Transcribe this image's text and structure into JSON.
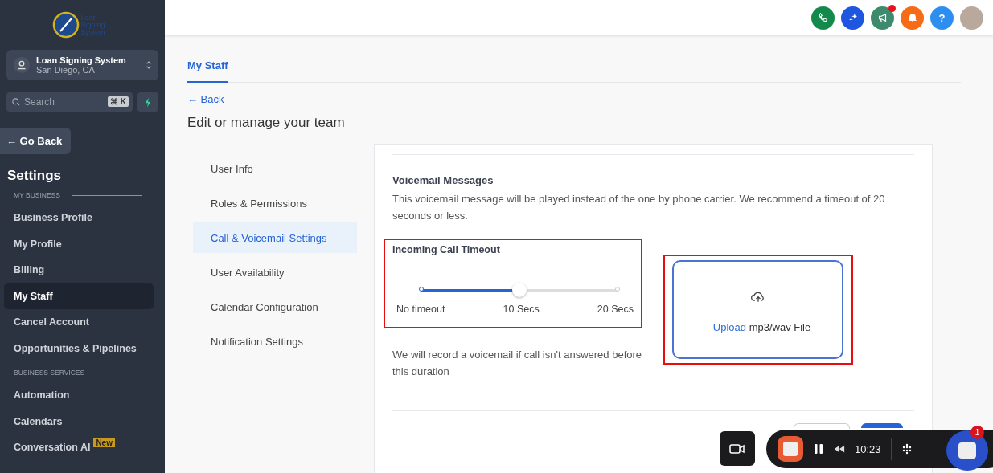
{
  "sidebar": {
    "logo_text": "Loan Signing System",
    "account": {
      "name": "Loan Signing System",
      "location": "San Diego, CA"
    },
    "search": {
      "placeholder": "Search",
      "shortcut": "⌘ K"
    },
    "back_button": "← Go Back",
    "title": "Settings",
    "sections": [
      {
        "heading": "MY BUSINESS",
        "items": [
          {
            "label": "Business Profile",
            "selected": false
          },
          {
            "label": "My Profile",
            "selected": false
          },
          {
            "label": "Billing",
            "selected": false
          },
          {
            "label": "My Staff",
            "selected": true
          },
          {
            "label": "Cancel Account",
            "selected": false
          },
          {
            "label": "Opportunities & Pipelines",
            "selected": false
          }
        ]
      },
      {
        "heading": "BUSINESS SERVICES",
        "items": [
          {
            "label": "Automation",
            "selected": false
          },
          {
            "label": "Calendars",
            "selected": false
          },
          {
            "label": "Conversation AI",
            "selected": false,
            "badge": "New"
          }
        ]
      }
    ]
  },
  "header": {
    "icons": [
      {
        "kind": "phone",
        "notification": false
      },
      {
        "kind": "sparkle",
        "notification": false
      },
      {
        "kind": "megaphone",
        "notification": true
      },
      {
        "kind": "bell",
        "notification": false
      },
      {
        "kind": "help",
        "label": "?",
        "notification": false
      },
      {
        "kind": "avatar",
        "notification": false
      }
    ]
  },
  "tabs": [
    {
      "label": "My Staff",
      "selected": true
    }
  ],
  "back_link": "← Back",
  "page_title": "Edit or manage your team",
  "nav": [
    {
      "label": "User Info",
      "selected": false
    },
    {
      "label": "Roles & Permissions",
      "selected": false
    },
    {
      "label": "Call & Voicemail Settings",
      "selected": true
    },
    {
      "label": "User Availability",
      "selected": false
    },
    {
      "label": "Calendar Configuration",
      "selected": false
    },
    {
      "label": "Notification Settings",
      "selected": false
    }
  ],
  "voicemail": {
    "heading": "Voicemail Messages",
    "description": "This voicemail message will be played instead of the one by phone carrier. We recommend a timeout of 20 seconds or less.",
    "timeout": {
      "label": "Incoming Call Timeout",
      "level": 0.5,
      "marks": [
        "No timeout",
        "10 Secs",
        "20 Secs"
      ]
    },
    "upload": {
      "link": "Upload",
      "text": "mp3/wav File"
    },
    "note": "We will record a voicemail if call isn't answered before this duration"
  },
  "recorder": {
    "time": "10:23",
    "badge": "1"
  }
}
